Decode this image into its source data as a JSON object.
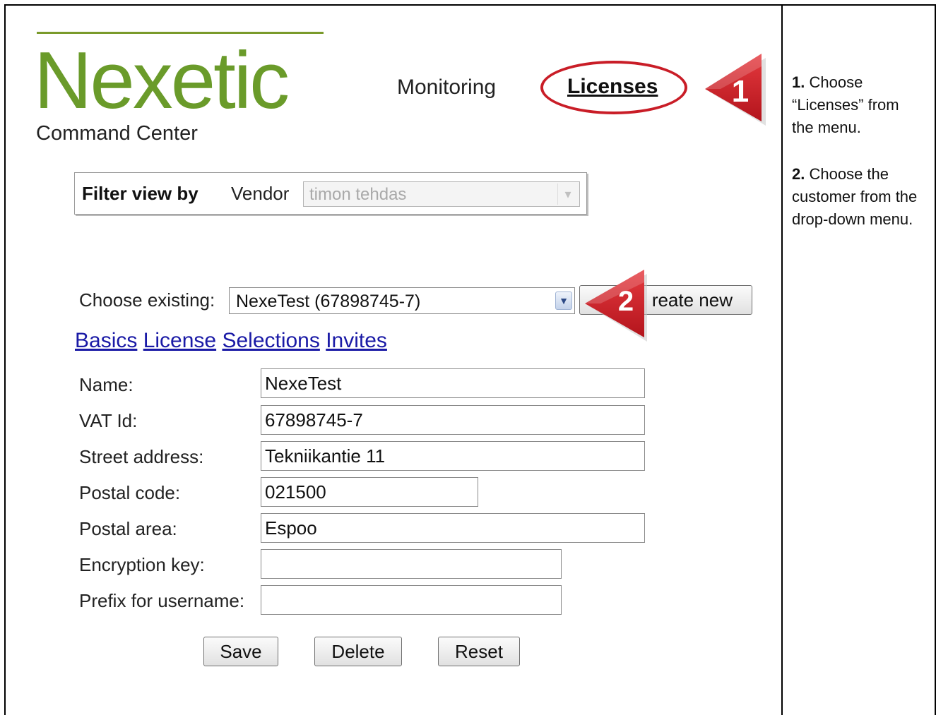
{
  "logo": {
    "brand": "Nexetic",
    "subtitle": "Command Center",
    "brand_color": "#6a9b2a"
  },
  "nav": {
    "monitoring": "Monitoring",
    "licenses": "Licenses"
  },
  "callouts": {
    "step1": "1",
    "step2": "2",
    "color": "#c91d27"
  },
  "filter": {
    "label": "Filter view by",
    "vendor_label": "Vendor",
    "vendor_value": "timon tehdas"
  },
  "customer": {
    "choose_label": "Choose existing:",
    "selected": "NexeTest (67898745-7)",
    "create_button": "reate new"
  },
  "tabs": [
    "Basics",
    "License",
    "Selections",
    "Invites"
  ],
  "form": {
    "fields": [
      {
        "label": "Name:",
        "value": "NexeTest"
      },
      {
        "label": "VAT Id:",
        "value": "67898745-7"
      },
      {
        "label": "Street address:",
        "value": "Tekniikantie 11"
      },
      {
        "label": "Postal code:",
        "value": "021500"
      },
      {
        "label": "Postal area:",
        "value": "Espoo"
      },
      {
        "label": "Encryption key:",
        "value": ""
      },
      {
        "label": "Prefix for username:",
        "value": ""
      }
    ]
  },
  "buttons": {
    "save": "Save",
    "delete": "Delete",
    "reset": "Reset"
  },
  "instructions": {
    "step1_num": "1.",
    "step1_text": "Choose “Licenses” from the menu.",
    "step2_num": "2.",
    "step2_text": "Choose the customer from the drop-down menu."
  }
}
